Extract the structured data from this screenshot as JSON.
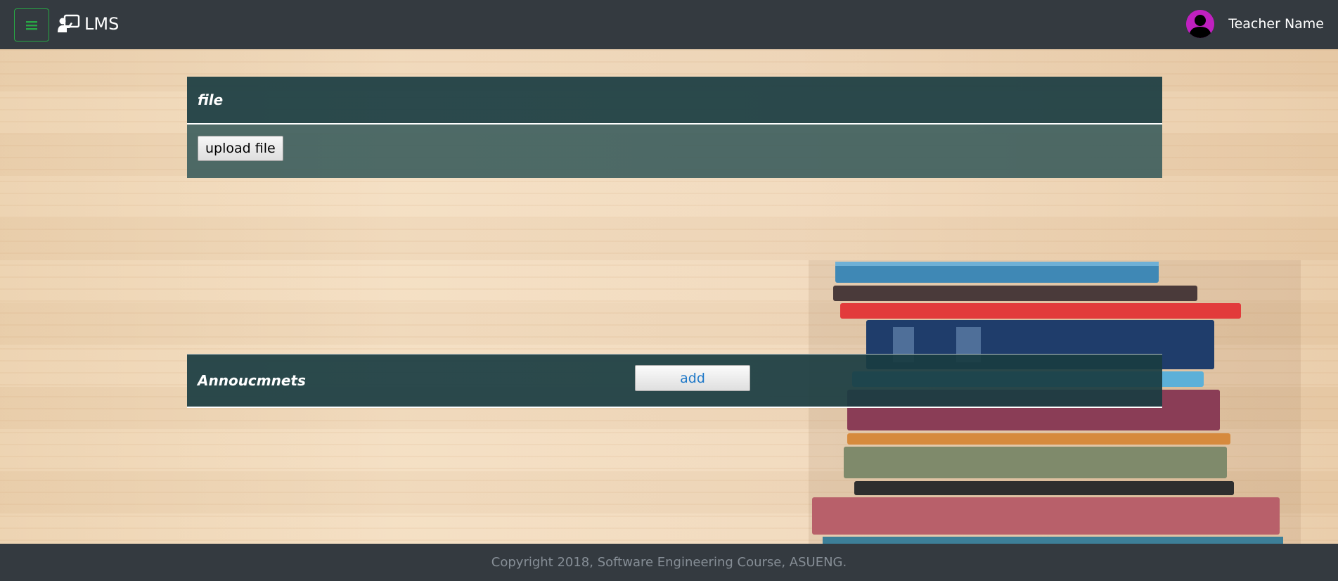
{
  "navbar": {
    "brand": "LMS",
    "user_name": "Teacher Name",
    "icons": {
      "menu": "hamburger-menu-icon",
      "brand": "teacher-board-icon",
      "avatar": "user-avatar-icon"
    },
    "colors": {
      "background": "#343a40",
      "menu_border": "#28a745",
      "avatar": "#c020c0"
    }
  },
  "file_panel": {
    "title": "file",
    "upload_label": "upload file"
  },
  "announcements_panel": {
    "title": "Annoucmnets",
    "add_label": "add"
  },
  "footer": {
    "copyright": "Copyright 2018, Software Engineering Course, ASUENG."
  }
}
